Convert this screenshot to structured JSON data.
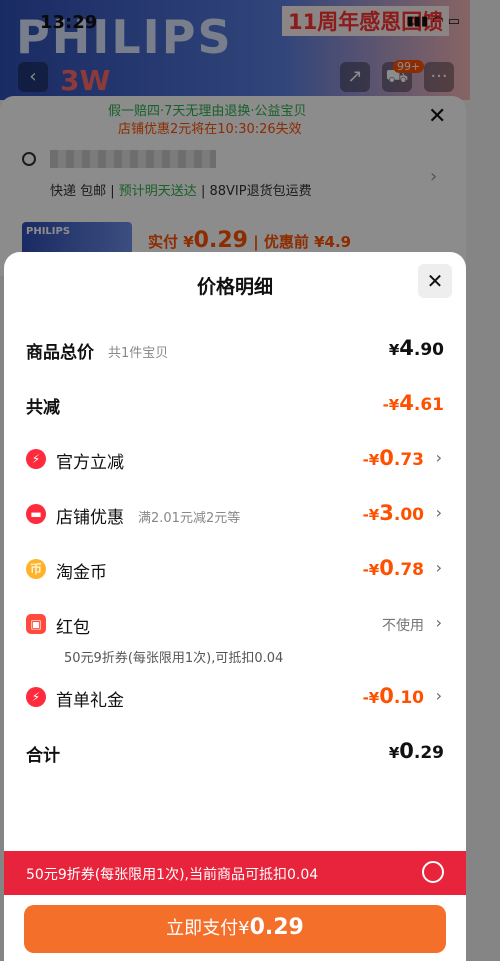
{
  "status_bar": {
    "time": "13:29",
    "icons": "▮▮▮ ◠ ▭"
  },
  "background": {
    "brand": "PHILIPS",
    "promo": "11周年感恩回馈",
    "banner_sub": "3W",
    "cart_badge": "99+",
    "guarantee": "假一赔四·7天无理由退换·公益宝贝",
    "shop_expire": "店铺优惠2元将在10:30:26失效",
    "shipping": {
      "express": "快递 包邮",
      "eta": "预计明天送达",
      "vip": "88VIP退货包运费"
    },
    "thumb_brand": "PHILIPS",
    "price_label": "实付 ¥",
    "price_value": "0.29",
    "price_before": "| 优惠前 ¥4.9"
  },
  "modal": {
    "title": "价格明细",
    "rows": [
      {
        "label": "商品总价",
        "note": "共1件宝贝",
        "currency": "¥",
        "amount_int": "4",
        "amount_dec": ".90"
      },
      {
        "label": "共减",
        "currency": "-¥",
        "amount_int": "4",
        "amount_dec": ".61"
      },
      {
        "label": "官方立减",
        "icon": "lightning-icon",
        "currency": "-¥",
        "amount_int": "0",
        "amount_dec": ".73"
      },
      {
        "label": "店铺优惠",
        "icon": "shop-icon",
        "note": "满2.01元减2元等",
        "currency": "-¥",
        "amount_int": "3",
        "amount_dec": ".00"
      },
      {
        "label": "淘金币",
        "icon": "coin-icon",
        "currency": "-¥",
        "amount_int": "0",
        "amount_dec": ".78"
      },
      {
        "label": "红包",
        "icon": "red-envelope-icon",
        "status": "不使用",
        "subnote": "50元9折券(每张限用1次),可抵扣0.04"
      },
      {
        "label": "首单礼金",
        "icon": "lightning-icon",
        "currency": "-¥",
        "amount_int": "0",
        "amount_dec": ".10"
      },
      {
        "label": "合计",
        "currency": "¥",
        "amount_int": "0",
        "amount_dec": ".29"
      }
    ]
  },
  "coupon_bar": {
    "text": "50元9折券(每张限用1次),当前商品可抵扣0.04"
  },
  "pay_button": {
    "label": "立即支付¥",
    "amount": "0.29"
  },
  "colors": {
    "accent": "#ff5000",
    "coupon_bar": "#e8243c",
    "pay_button": "#f36f2a",
    "green": "#2eaf4c"
  }
}
